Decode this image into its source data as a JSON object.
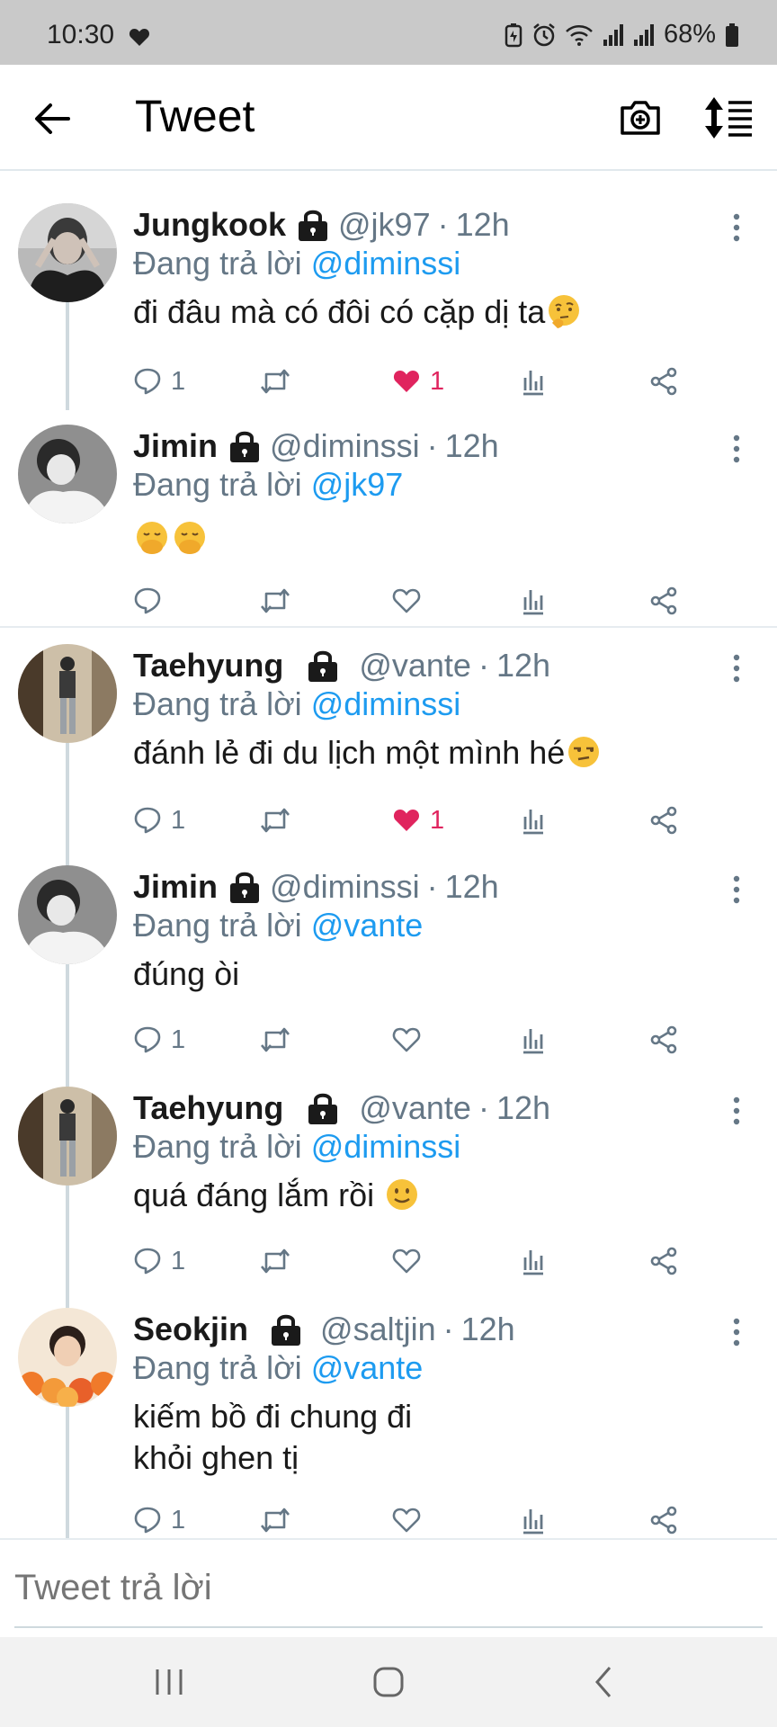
{
  "status": {
    "time": "10:30",
    "battery": "68%"
  },
  "header": {
    "title": "Tweet"
  },
  "composer": {
    "placeholder": "Tweet trả lời"
  },
  "tweets": [
    {
      "name": "Jungkook",
      "handle": "@jk97",
      "time": "12h",
      "reply_prefix": "Đang trả lời",
      "reply_to": "@diminssi",
      "text": "đi đâu mà có đôi có cặp dị ta",
      "emoji": "thinking-face",
      "replies": "1",
      "likes": "1",
      "liked": true
    },
    {
      "name": "Jimin",
      "handle": "@diminssi",
      "time": "12h",
      "reply_prefix": "Đang trả lời",
      "reply_to": "@jk97",
      "text": "",
      "emoji": "hand-over-mouth-face x2",
      "replies": "",
      "likes": "",
      "liked": false
    },
    {
      "name": "Taehyung",
      "handle": "@vante",
      "time": "12h",
      "reply_prefix": "Đang trả lời",
      "reply_to": "@diminssi",
      "text": "đánh lẻ đi du lịch một mình hé",
      "emoji": "unamused-face",
      "replies": "1",
      "likes": "1",
      "liked": true
    },
    {
      "name": "Jimin",
      "handle": "@diminssi",
      "time": "12h",
      "reply_prefix": "Đang trả lời",
      "reply_to": "@vante",
      "text": "đúng òi",
      "replies": "1",
      "likes": "",
      "liked": false
    },
    {
      "name": "Taehyung",
      "handle": "@vante",
      "time": "12h",
      "reply_prefix": "Đang trả lời",
      "reply_to": "@diminssi",
      "text": "quá đáng lắm rồi",
      "emoji": "slightly-smiling-face",
      "replies": "1",
      "likes": "",
      "liked": false
    },
    {
      "name": "Seokjin",
      "handle": "@saltjin",
      "time": "12h",
      "reply_prefix": "Đang trả lời",
      "reply_to": "@vante",
      "text_lines": [
        "kiếm bồ đi chung đi",
        "khỏi ghen tị"
      ],
      "replies": "1",
      "likes": "",
      "liked": false
    }
  ],
  "icons": {
    "reply": "speech-bubble-icon",
    "retweet": "retweet-icon",
    "like": "heart-icon",
    "stats": "bar-chart-icon",
    "share": "share-icon",
    "lock": "lock-icon",
    "more": "vertical-dots-icon"
  },
  "colors": {
    "link": "#1d9bf0",
    "like": "#e0245e",
    "muted": "#657786"
  }
}
